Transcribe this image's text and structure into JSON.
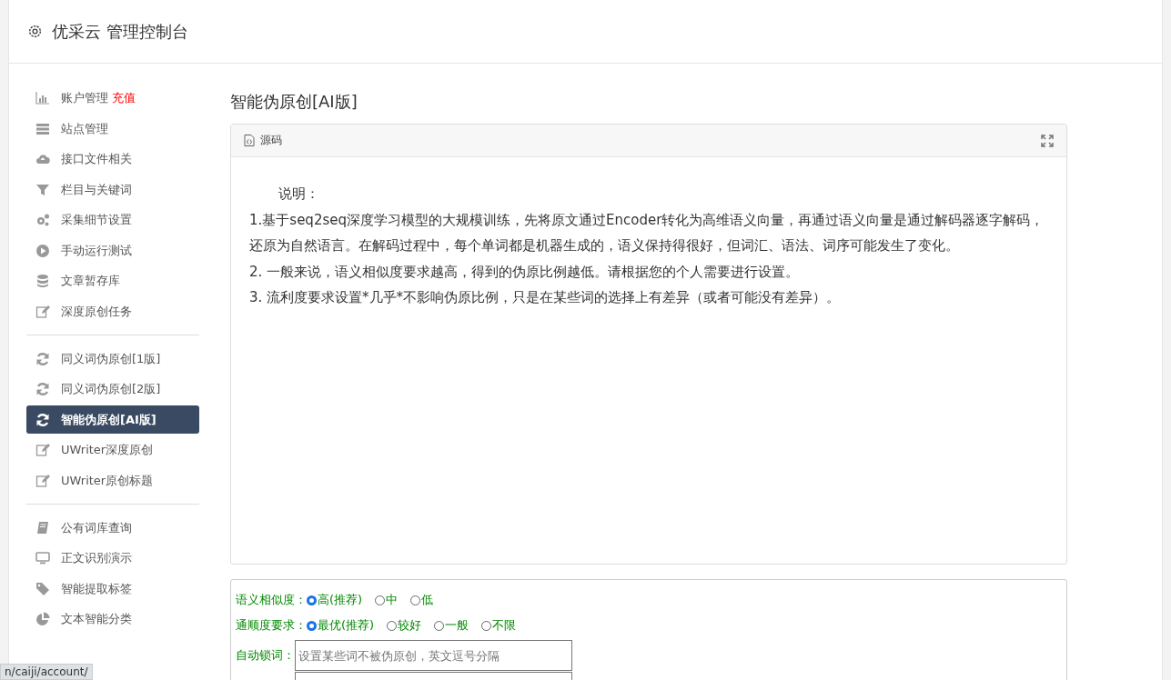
{
  "header": {
    "title": "优采云 管理控制台"
  },
  "sidebar": {
    "groups": [
      [
        {
          "label": "账户管理",
          "badge": "充值",
          "kind": "chart",
          "selected": false
        },
        {
          "label": "站点管理",
          "kind": "server",
          "selected": false
        },
        {
          "label": "接口文件相关",
          "kind": "cloud",
          "selected": false
        },
        {
          "label": "栏目与关键词",
          "kind": "filter",
          "selected": false
        },
        {
          "label": "采集细节设置",
          "kind": "gears",
          "selected": false
        },
        {
          "label": "手动运行测试",
          "kind": "play",
          "selected": false
        },
        {
          "label": "文章暂存库",
          "kind": "database",
          "selected": false
        },
        {
          "label": "深度原创任务",
          "kind": "edit",
          "selected": false
        }
      ],
      [
        {
          "label": "同义词伪原创[1版]",
          "kind": "refresh",
          "selected": false
        },
        {
          "label": "同义词伪原创[2版]",
          "kind": "refresh",
          "selected": false
        },
        {
          "label": "智能伪原创[AI版]",
          "kind": "refresh",
          "selected": true
        },
        {
          "label": "UWriter深度原创",
          "kind": "edit",
          "selected": false
        },
        {
          "label": "UWriter原创标题",
          "kind": "edit",
          "selected": false
        }
      ],
      [
        {
          "label": "公有词库查询",
          "kind": "book",
          "selected": false
        },
        {
          "label": "正文识别演示",
          "kind": "monitor",
          "selected": false
        },
        {
          "label": "智能提取标签",
          "kind": "tag",
          "selected": false
        },
        {
          "label": "文本智能分类",
          "kind": "pie",
          "selected": false
        }
      ]
    ]
  },
  "content": {
    "heading": "智能伪原创[AI版]",
    "editor": {
      "toolbar_label": "源码",
      "lines": [
        "说明：",
        "1.基于seq2seq深度学习模型的大规模训练，先将原文通过Encoder转化为高维语义向量，再通过语义向量是通过解码器逐字解码，还原为自然语言。在解码过程中，每个单词都是机器生成的，语义保持得很好，但词汇、语法、词序可能发生了变化。",
        "2. 一般来说，语义相似度要求越高，得到的伪原比例越低。请根据您的个人需要进行设置。",
        "3. 流利度要求设置*几乎*不影响伪原比例，只是在某些词的选择上有差异（或者可能没有差异）。"
      ]
    },
    "options": [
      {
        "label": "语义相似度：",
        "choices": [
          {
            "label": "高(推荐)",
            "selected": true
          },
          {
            "label": "中",
            "selected": false
          },
          {
            "label": "低",
            "selected": false
          }
        ]
      },
      {
        "label": "通顺度要求：",
        "choices": [
          {
            "label": "最优(推荐)",
            "selected": true
          },
          {
            "label": "较好",
            "selected": false
          },
          {
            "label": "一般",
            "selected": false
          },
          {
            "label": "不限",
            "selected": false
          }
        ]
      }
    ],
    "lock_words": {
      "label": "自动锁词：",
      "placeholder": "设置某些词不被伪原创，英文逗号分隔"
    }
  },
  "status_url": "n/caiji/account/"
}
